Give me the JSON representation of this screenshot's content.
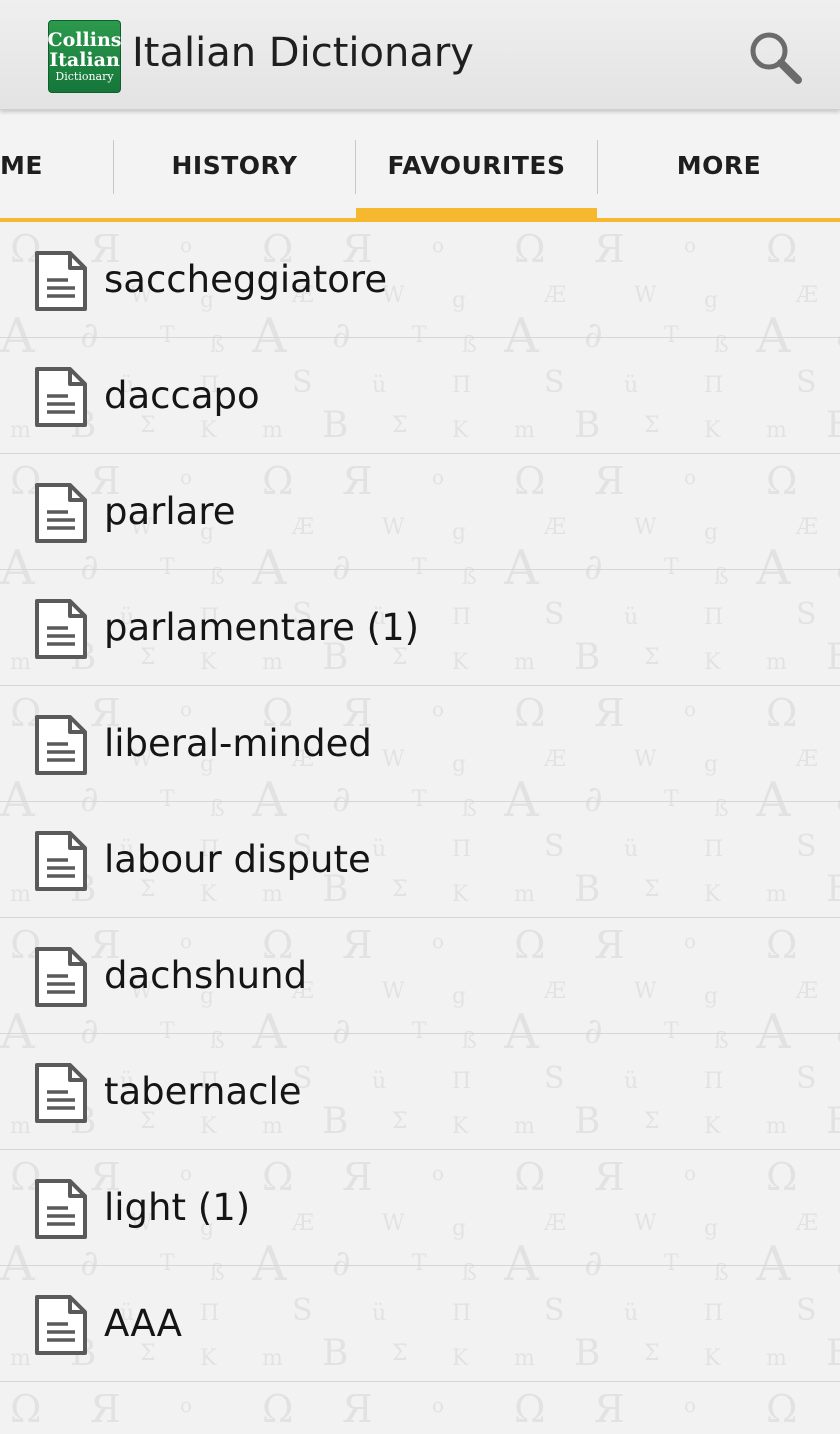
{
  "app_bar": {
    "logo": {
      "line1": "Collins",
      "line2": "Italian",
      "line3": "Dictionary"
    },
    "title": "Italian Dictionary",
    "search_icon": "search-icon"
  },
  "tabs": [
    {
      "label": "HOME",
      "visible_label": "ME"
    },
    {
      "label": "HISTORY",
      "visible_label": "HISTORY"
    },
    {
      "label": "FAVOURITES",
      "visible_label": "FAVOURITES",
      "selected": true
    },
    {
      "label": "MORE",
      "visible_label": "MORE"
    }
  ],
  "favourites": [
    {
      "label": "saccheggiatore",
      "icon": "document-icon"
    },
    {
      "label": "daccapo",
      "icon": "document-icon"
    },
    {
      "label": "parlare",
      "icon": "document-icon"
    },
    {
      "label": "parlamentare (1)",
      "icon": "document-icon"
    },
    {
      "label": "liberal-minded",
      "icon": "document-icon"
    },
    {
      "label": "labour dispute",
      "icon": "document-icon"
    },
    {
      "label": "dachshund",
      "icon": "document-icon"
    },
    {
      "label": "tabernacle",
      "icon": "document-icon"
    },
    {
      "label": "light (1)",
      "icon": "document-icon"
    },
    {
      "label": "AAA",
      "icon": "document-icon"
    }
  ],
  "colors": {
    "accent": "#f5b82e",
    "logo_green": "#1f8a44",
    "background": "#f2f2f2",
    "text": "#151515"
  }
}
